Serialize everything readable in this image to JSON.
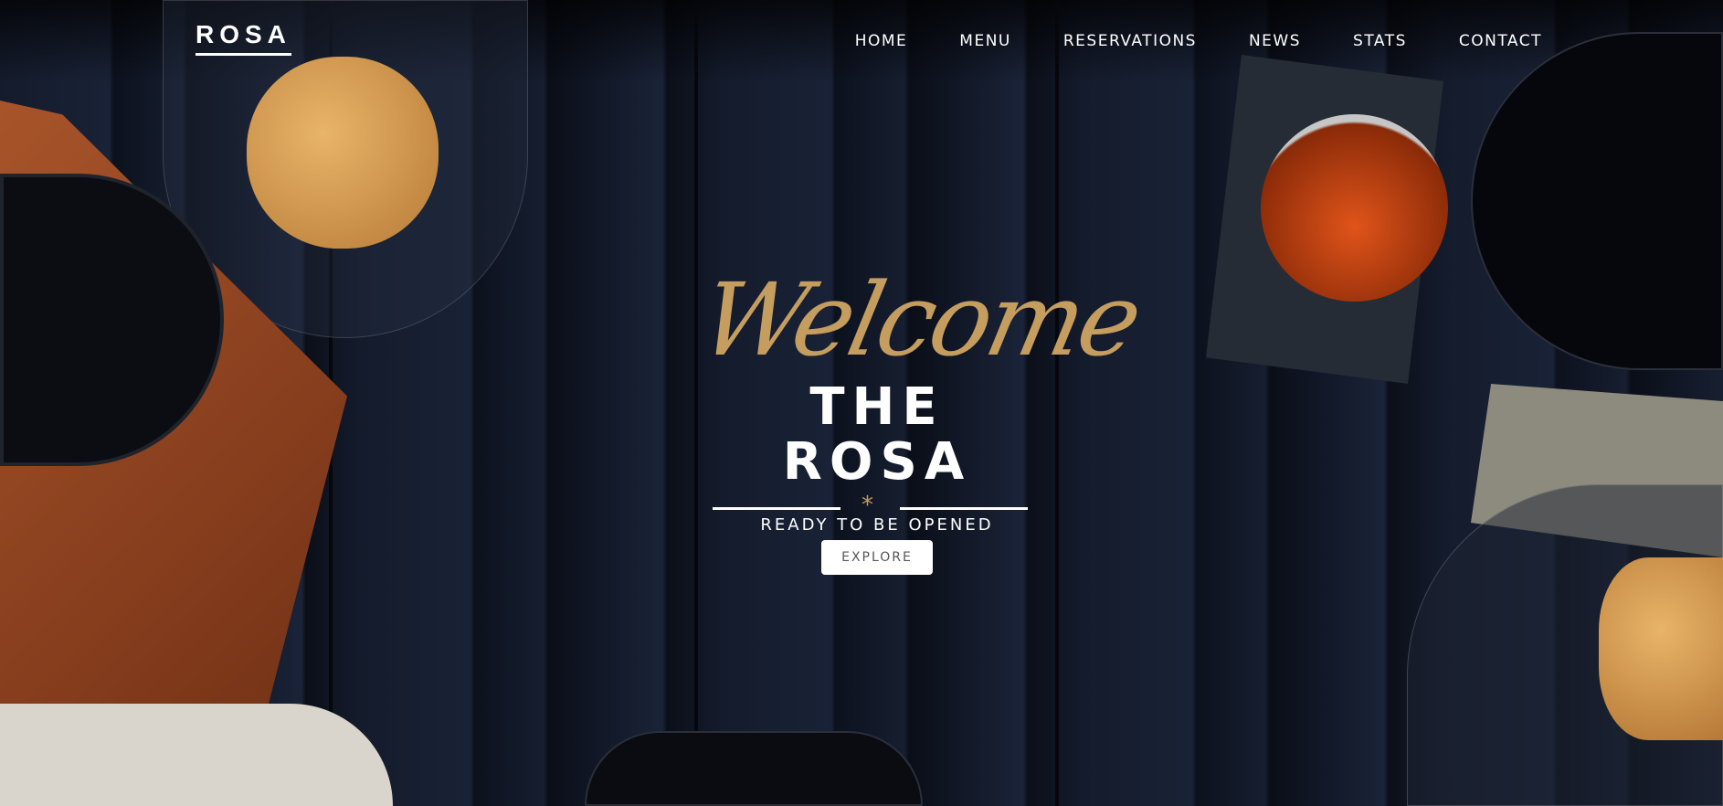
{
  "brand": {
    "logo": "ROSA"
  },
  "nav": {
    "items": [
      "HOME",
      "MENU",
      "RESERVATIONS",
      "NEWS",
      "STATS",
      "CONTACT"
    ]
  },
  "hero": {
    "script": "Welcome",
    "title": "THE ROSA",
    "subtitle": "READY TO BE OPENED",
    "cta": "EXPLORE"
  },
  "colors": {
    "accent": "#c59d5f",
    "background": "#121829"
  }
}
